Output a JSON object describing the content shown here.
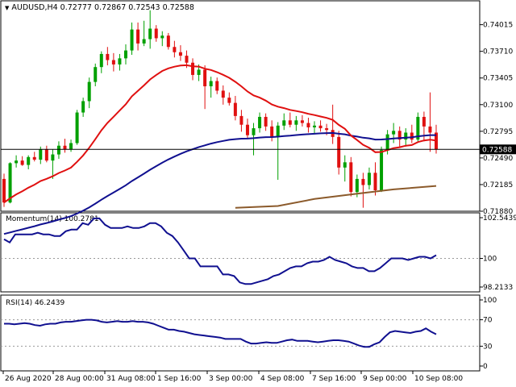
{
  "header": {
    "symbol_line": "AUDUSD,H4  0.72777 0.72867 0.72543 0.72588",
    "collapse_glyph": "triangle-down-icon"
  },
  "indicators": {
    "momentum": {
      "label": "Momentum(14) 100.2781",
      "ticks": [
        "102.5439",
        "100",
        "98.2133"
      ]
    },
    "rsi": {
      "label": "RSI(14) 46.2439",
      "ticks": [
        "100",
        "70",
        "30",
        "0"
      ]
    }
  },
  "colors": {
    "bull": "#00a000",
    "bear": "#e01010",
    "ema_fast": "#e01010",
    "ema_mid": "#101090",
    "ema_slow": "#8b5a2b",
    "indicator_line": "#101090",
    "current_price_bg": "#000000"
  },
  "chart_data": {
    "type": "candlestick",
    "price_axis": {
      "ticks": [
        "0.74015",
        "0.73710",
        "0.73405",
        "0.73100",
        "0.72795",
        "0.72490",
        "0.72185",
        "0.71880"
      ],
      "ylim": [
        0.7188,
        0.7415
      ]
    },
    "current_price": "0.72588",
    "time_axis": [
      "26 Aug 2020",
      "28 Aug 00:00",
      "31 Aug 08:00",
      "1 Sep 16:00",
      "3 Sep 00:00",
      "4 Sep 08:00",
      "7 Sep 16:00",
      "9 Sep 00:00",
      "10 Sep 08:00"
    ],
    "candles": [
      [
        0.7225,
        0.7231,
        0.7193,
        0.7198
      ],
      [
        0.7198,
        0.7244,
        0.7197,
        0.7243
      ],
      [
        0.7243,
        0.7252,
        0.7238,
        0.7246
      ],
      [
        0.7246,
        0.7251,
        0.724,
        0.7241
      ],
      [
        0.7241,
        0.7252,
        0.7236,
        0.725
      ],
      [
        0.725,
        0.7256,
        0.7245,
        0.7247
      ],
      [
        0.7247,
        0.7262,
        0.7242,
        0.7259
      ],
      [
        0.7259,
        0.7263,
        0.7244,
        0.7246
      ],
      [
        0.7246,
        0.7259,
        0.7225,
        0.7253
      ],
      [
        0.7253,
        0.7268,
        0.7248,
        0.7263
      ],
      [
        0.7263,
        0.7271,
        0.7255,
        0.7259
      ],
      [
        0.7259,
        0.727,
        0.7256,
        0.7266
      ],
      [
        0.7266,
        0.7304,
        0.7264,
        0.7301
      ],
      [
        0.7301,
        0.7318,
        0.7296,
        0.7314
      ],
      [
        0.7314,
        0.7341,
        0.7306,
        0.7336
      ],
      [
        0.7336,
        0.7357,
        0.7331,
        0.7353
      ],
      [
        0.7353,
        0.7371,
        0.7346,
        0.7368
      ],
      [
        0.7368,
        0.7376,
        0.7355,
        0.7361
      ],
      [
        0.7361,
        0.7369,
        0.7348,
        0.7356
      ],
      [
        0.7356,
        0.7368,
        0.7349,
        0.7363
      ],
      [
        0.7363,
        0.7379,
        0.7356,
        0.7372
      ],
      [
        0.7372,
        0.7404,
        0.7367,
        0.7396
      ],
      [
        0.7396,
        0.7404,
        0.7372,
        0.738
      ],
      [
        0.738,
        0.7406,
        0.7377,
        0.7385
      ],
      [
        0.7385,
        0.7418,
        0.7374,
        0.7397
      ],
      [
        0.7397,
        0.7401,
        0.7382,
        0.7386
      ],
      [
        0.7386,
        0.7394,
        0.7377,
        0.7389
      ],
      [
        0.7389,
        0.7392,
        0.7373,
        0.7376
      ],
      [
        0.7376,
        0.7383,
        0.7364,
        0.737
      ],
      [
        0.737,
        0.7378,
        0.736,
        0.7366
      ],
      [
        0.7366,
        0.7372,
        0.7352,
        0.7358
      ],
      [
        0.7358,
        0.7363,
        0.7338,
        0.7344
      ],
      [
        0.7344,
        0.7356,
        0.7337,
        0.735
      ],
      [
        0.735,
        0.7355,
        0.7305,
        0.7331
      ],
      [
        0.7331,
        0.7342,
        0.7318,
        0.7337
      ],
      [
        0.7337,
        0.7341,
        0.7322,
        0.7326
      ],
      [
        0.7326,
        0.7332,
        0.731,
        0.7318
      ],
      [
        0.7318,
        0.7324,
        0.7309,
        0.7312
      ],
      [
        0.7312,
        0.732,
        0.7292,
        0.7297
      ],
      [
        0.7297,
        0.7304,
        0.7279,
        0.7287
      ],
      [
        0.7287,
        0.7294,
        0.7272,
        0.7275
      ],
      [
        0.7275,
        0.7289,
        0.7252,
        0.7283
      ],
      [
        0.7283,
        0.7301,
        0.7278,
        0.7296
      ],
      [
        0.7296,
        0.73,
        0.728,
        0.7285
      ],
      [
        0.7285,
        0.7292,
        0.7268,
        0.7273
      ],
      [
        0.7273,
        0.729,
        0.7224,
        0.7286
      ],
      [
        0.7286,
        0.73,
        0.7281,
        0.7292
      ],
      [
        0.7292,
        0.7301,
        0.7284,
        0.7287
      ],
      [
        0.7287,
        0.7297,
        0.728,
        0.7292
      ],
      [
        0.7292,
        0.7298,
        0.7285,
        0.7289
      ],
      [
        0.7289,
        0.7295,
        0.7278,
        0.7284
      ],
      [
        0.7284,
        0.7291,
        0.7277,
        0.7286
      ],
      [
        0.7286,
        0.7292,
        0.7279,
        0.7283
      ],
      [
        0.7283,
        0.7288,
        0.7275,
        0.7281
      ],
      [
        0.7281,
        0.731,
        0.7265,
        0.7273
      ],
      [
        0.7273,
        0.728,
        0.723,
        0.7238
      ],
      [
        0.7238,
        0.7252,
        0.7222,
        0.7244
      ],
      [
        0.7244,
        0.725,
        0.7205,
        0.721
      ],
      [
        0.721,
        0.723,
        0.7204,
        0.7225
      ],
      [
        0.7225,
        0.7232,
        0.7192,
        0.7218
      ],
      [
        0.7218,
        0.7238,
        0.7213,
        0.7232
      ],
      [
        0.7232,
        0.7244,
        0.7206,
        0.7212
      ],
      [
        0.7212,
        0.7262,
        0.721,
        0.7258
      ],
      [
        0.7258,
        0.7281,
        0.7253,
        0.7276
      ],
      [
        0.7276,
        0.7289,
        0.7266,
        0.728
      ],
      [
        0.728,
        0.7285,
        0.7262,
        0.727
      ],
      [
        0.727,
        0.7283,
        0.7262,
        0.7278
      ],
      [
        0.7278,
        0.7287,
        0.7266,
        0.727
      ],
      [
        0.727,
        0.7301,
        0.7268,
        0.7296
      ],
      [
        0.7296,
        0.7302,
        0.7268,
        0.7285
      ],
      [
        0.7285,
        0.7324,
        0.7256,
        0.7278
      ],
      [
        0.7278,
        0.7287,
        0.7254,
        0.7259
      ]
    ],
    "ema_slow_values": [
      [
        0.718,
        0.7192
      ],
      [
        0.72,
        0.7194
      ],
      [
        0.723,
        0.7202
      ],
      [
        0.726,
        0.7208
      ],
      [
        0.7285,
        0.7213
      ],
      [
        0.73,
        0.7217
      ]
    ],
    "momentum_values": [
      101.2,
      101.0,
      101.5,
      101.5,
      101.5,
      101.5,
      101.6,
      101.5,
      101.5,
      101.4,
      101.4,
      101.7,
      101.8,
      101.8,
      102.2,
      102.1,
      102.5,
      102.5,
      102.1,
      101.9,
      101.9,
      101.9,
      102.0,
      101.9,
      101.9,
      102.0,
      102.2,
      102.2,
      102.0,
      101.6,
      101.4,
      101.0,
      100.5,
      100.0,
      100.0,
      99.5,
      99.5,
      99.5,
      99.5,
      99.0,
      99.0,
      98.9,
      98.5,
      98.4,
      98.4,
      98.5,
      98.6,
      98.7,
      98.9,
      99.0,
      99.2,
      99.4,
      99.5,
      99.5,
      99.7,
      99.8,
      99.8,
      99.9,
      100.1,
      99.9,
      99.8,
      99.7,
      99.5,
      99.4,
      99.4,
      99.2,
      99.2,
      99.4,
      99.7,
      100.0,
      100.0,
      100.0,
      99.9,
      100.0,
      100.1,
      100.1,
      100.0,
      100.2
    ],
    "rsi_values": [
      64,
      64,
      63,
      64,
      65,
      64,
      62,
      61,
      63,
      64,
      64,
      66,
      67,
      67,
      68,
      69,
      70,
      70,
      69,
      67,
      66,
      67,
      68,
      67,
      67,
      68,
      67,
      67,
      66,
      64,
      61,
      58,
      55,
      55,
      53,
      52,
      50,
      48,
      47,
      46,
      45,
      44,
      43,
      41,
      41,
      41,
      41,
      37,
      34,
      34,
      35,
      36,
      35,
      35,
      37,
      39,
      40,
      38,
      38,
      38,
      37,
      36,
      37,
      38,
      39,
      39,
      38,
      37,
      34,
      31,
      29,
      29,
      33,
      36,
      44,
      51,
      53,
      52,
      51,
      50,
      52,
      53,
      57,
      52,
      48
    ]
  }
}
